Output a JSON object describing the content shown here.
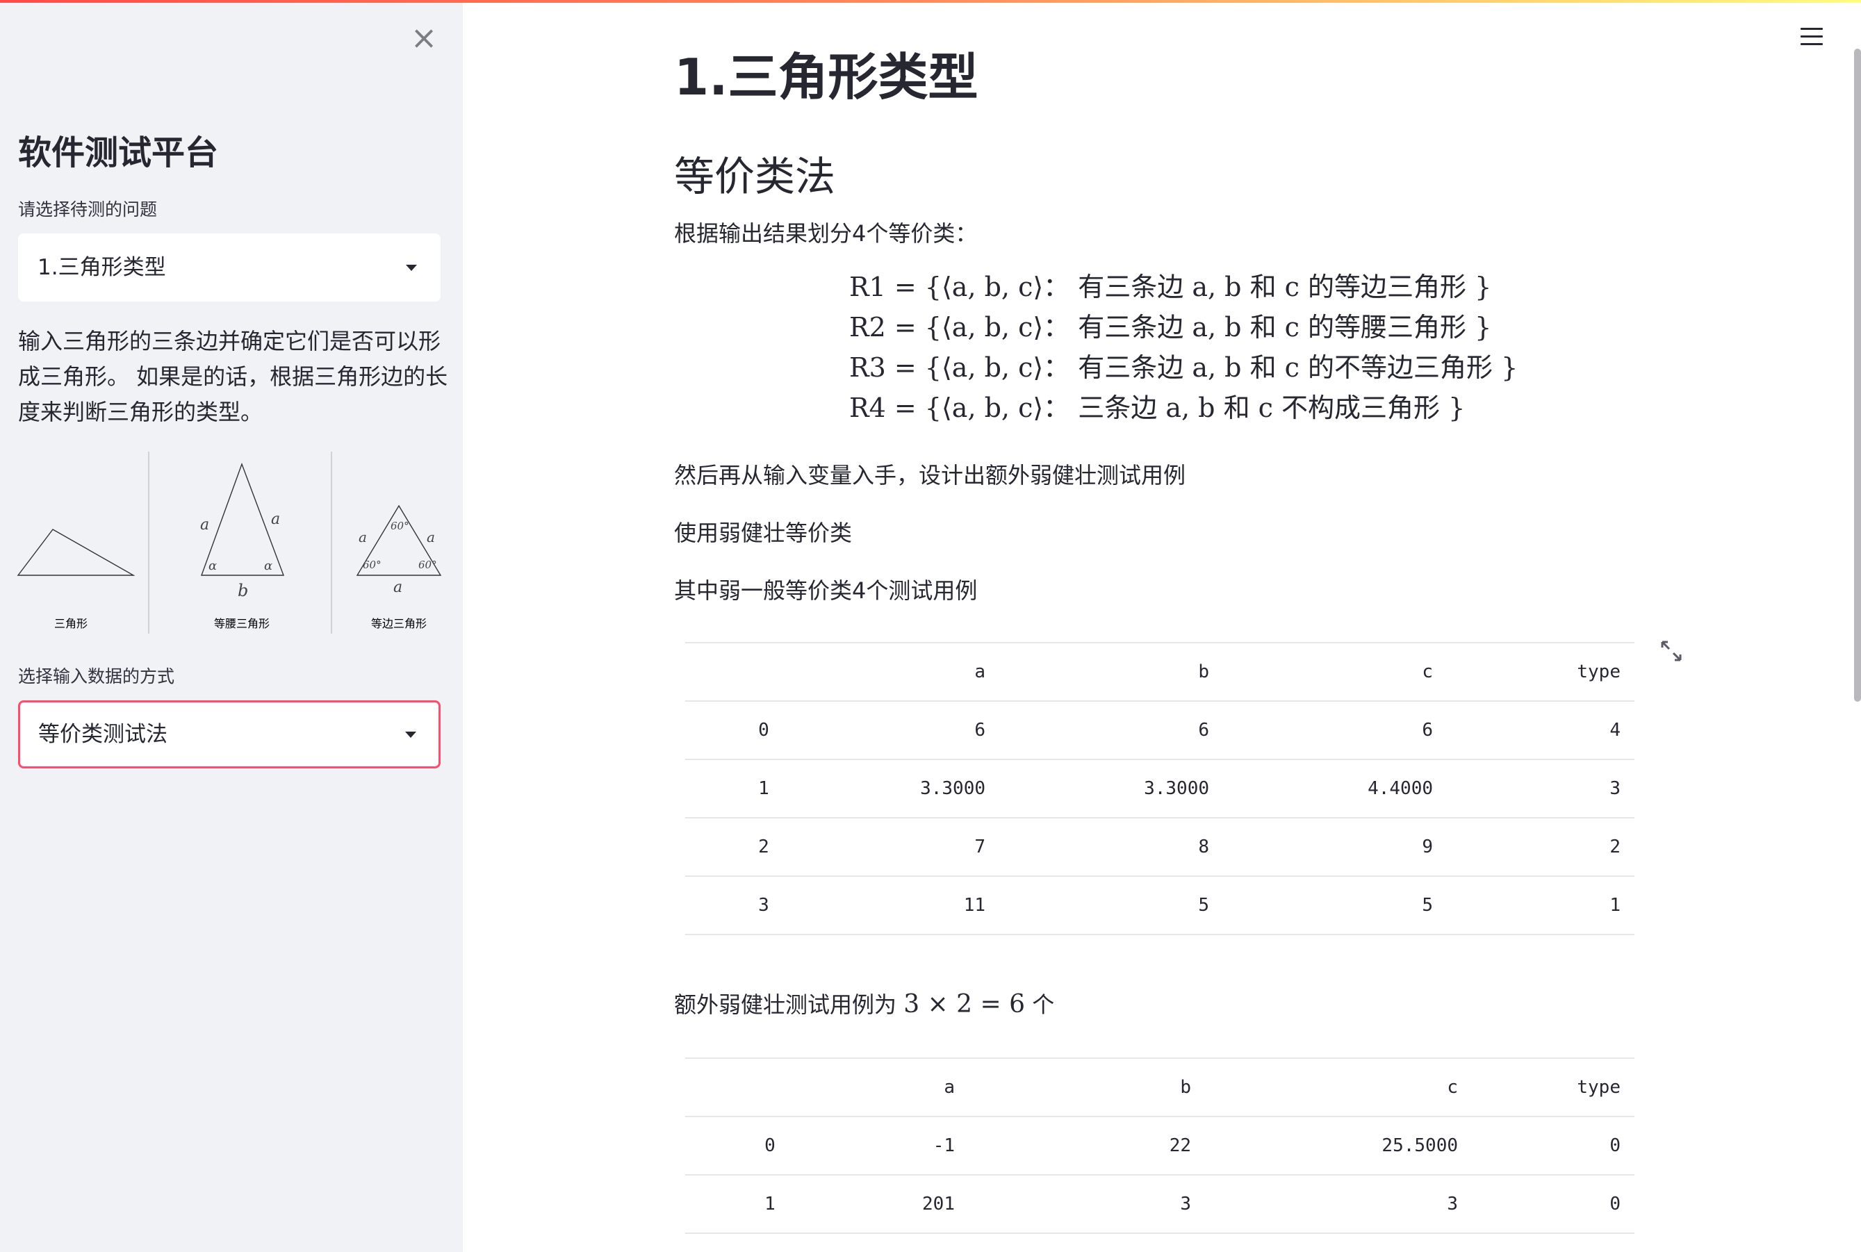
{
  "sidebar": {
    "title": "软件测试平台",
    "problem_label": "请选择待测的问题",
    "problem_selected": "1.三角形类型",
    "description": "输入三角形的三条边并确定它们是否可以形成三角形。 如果是的话，根据三角形边的长度来判断三角形的类型。",
    "triangles": [
      {
        "caption": "三角形"
      },
      {
        "caption": "等腰三角形",
        "labels": {
          "left": "a",
          "right": "a",
          "base": "b",
          "angle": "α"
        }
      },
      {
        "caption": "等边三角形",
        "labels": {
          "left": "a",
          "right": "a",
          "base": "a",
          "angle": "60°"
        }
      }
    ],
    "method_label": "选择输入数据的方式",
    "method_selected": "等价类测试法"
  },
  "main": {
    "title": "1.三角形类型",
    "section": "等价类法",
    "intro": "根据输出结果划分4个等价类：",
    "equivalence_classes": [
      {
        "name": "R1",
        "text": "R1 = {⟨a, b, c⟩： 有三条边 a, b 和 c 的等边三角形 }"
      },
      {
        "name": "R2",
        "text": "R2 = {⟨a, b, c⟩： 有三条边 a, b 和 c 的等腰三角形 }"
      },
      {
        "name": "R3",
        "text": "R3 = {⟨a, b, c⟩： 有三条边 a, b 和 c 的不等边三角形 }"
      },
      {
        "name": "R4",
        "text": "R4 = {⟨a, b, c⟩： 三条边 a, b 和 c 不构成三角形 }"
      }
    ],
    "para_then": "然后再从输入变量入手，设计出额外弱健壮测试用例",
    "para_use": "使用弱健壮等价类",
    "para_weak": "其中弱一般等价类4个测试用例",
    "table1": {
      "columns": [
        "",
        "a",
        "b",
        "c",
        "type"
      ],
      "rows": [
        [
          "0",
          "6",
          "6",
          "6",
          "4"
        ],
        [
          "1",
          "3.3000",
          "3.3000",
          "4.4000",
          "3"
        ],
        [
          "2",
          "7",
          "8",
          "9",
          "2"
        ],
        [
          "3",
          "11",
          "5",
          "5",
          "1"
        ]
      ]
    },
    "extra_prefix": "额外弱健壮测试用例为",
    "extra_math": "3 × 2 = 6",
    "extra_suffix": "个",
    "table2": {
      "columns": [
        "",
        "a",
        "b",
        "c",
        "type"
      ],
      "rows": [
        [
          "0",
          "-1",
          "22",
          "25.5000",
          "0"
        ],
        [
          "1",
          "201",
          "3",
          "3",
          "0"
        ]
      ]
    }
  },
  "icons": {
    "close": "close-icon",
    "menu": "hamburger-menu-icon",
    "expand": "fullscreen-expand-icon",
    "dropdown": "caret-down-icon"
  },
  "colors": {
    "sidebar_bg": "#f0f2f6",
    "accent": "#ff4b6e",
    "text": "#262730"
  }
}
